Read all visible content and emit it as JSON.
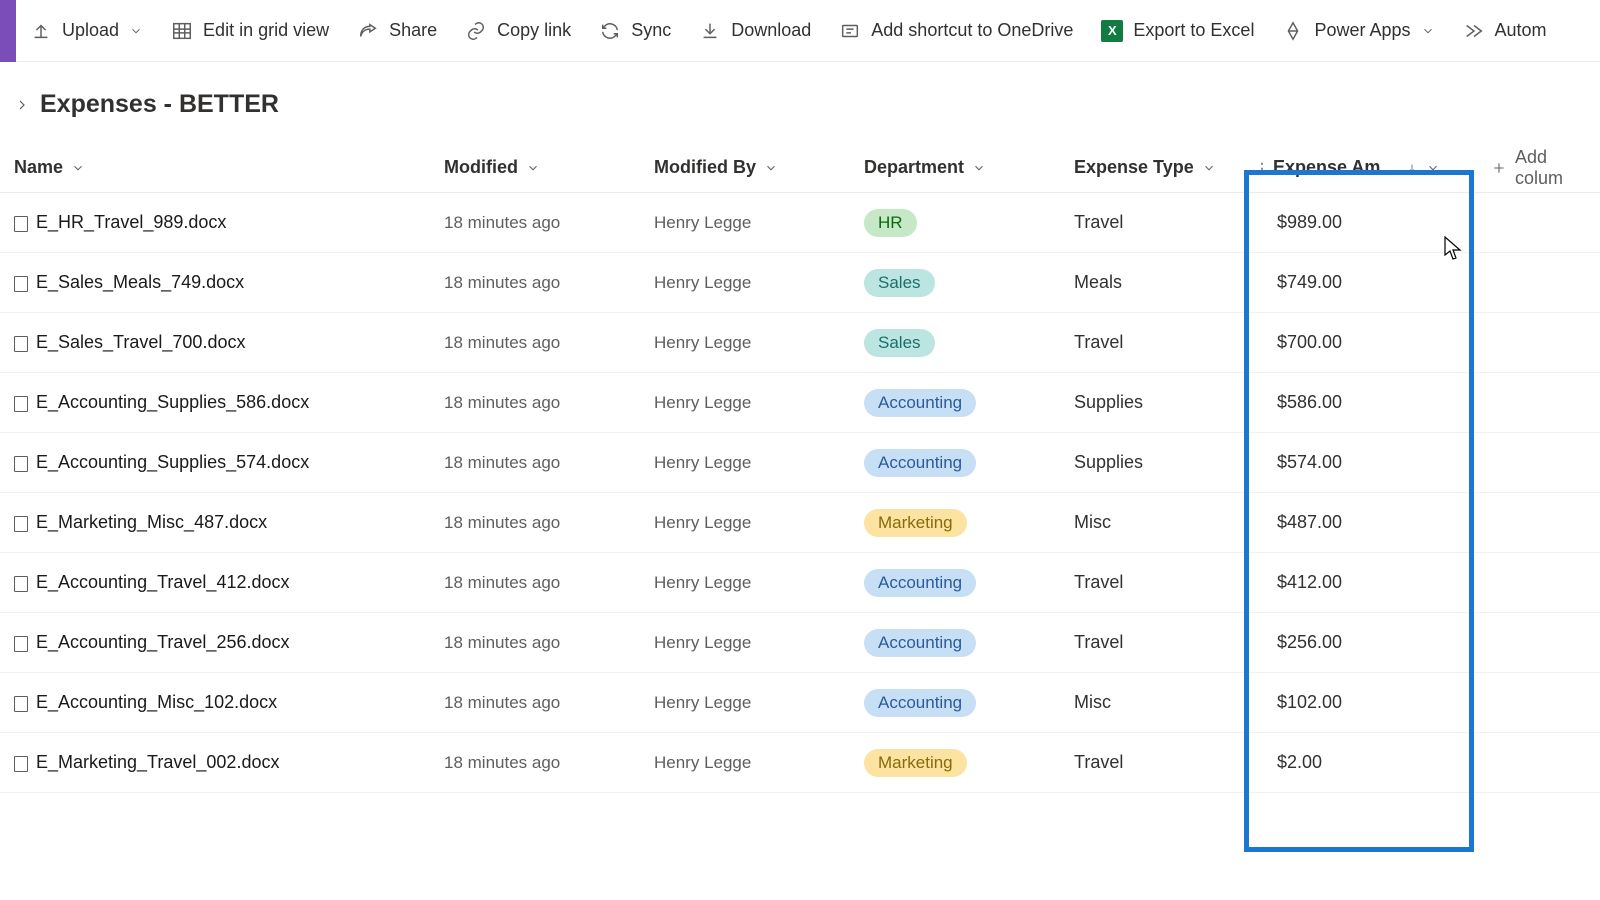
{
  "toolbar": {
    "upload": "Upload",
    "edit_grid": "Edit in grid view",
    "share": "Share",
    "copy_link": "Copy link",
    "sync": "Sync",
    "download": "Download",
    "add_shortcut": "Add shortcut to OneDrive",
    "export_excel": "Export to Excel",
    "power_apps": "Power Apps",
    "automate": "Autom"
  },
  "breadcrumb": {
    "title": "Expenses - BETTER"
  },
  "columns": {
    "name": "Name",
    "modified": "Modified",
    "modified_by": "Modified By",
    "department": "Department",
    "expense_type": "Expense Type",
    "expense_amount": "Expense Am…",
    "add": "Add colum"
  },
  "dept_pills": {
    "HR": "pill-hr",
    "Sales": "pill-sales",
    "Accounting": "pill-accounting",
    "Marketing": "pill-marketing"
  },
  "rows": [
    {
      "name": "E_HR_Travel_989.docx",
      "modified": "18 minutes ago",
      "by": "Henry Legge",
      "dept": "HR",
      "type": "Travel",
      "amount": "$989.00"
    },
    {
      "name": "E_Sales_Meals_749.docx",
      "modified": "18 minutes ago",
      "by": "Henry Legge",
      "dept": "Sales",
      "type": "Meals",
      "amount": "$749.00"
    },
    {
      "name": "E_Sales_Travel_700.docx",
      "modified": "18 minutes ago",
      "by": "Henry Legge",
      "dept": "Sales",
      "type": "Travel",
      "amount": "$700.00"
    },
    {
      "name": "E_Accounting_Supplies_586.docx",
      "modified": "18 minutes ago",
      "by": "Henry Legge",
      "dept": "Accounting",
      "type": "Supplies",
      "amount": "$586.00"
    },
    {
      "name": "E_Accounting_Supplies_574.docx",
      "modified": "18 minutes ago",
      "by": "Henry Legge",
      "dept": "Accounting",
      "type": "Supplies",
      "amount": "$574.00"
    },
    {
      "name": "E_Marketing_Misc_487.docx",
      "modified": "18 minutes ago",
      "by": "Henry Legge",
      "dept": "Marketing",
      "type": "Misc",
      "amount": "$487.00"
    },
    {
      "name": "E_Accounting_Travel_412.docx",
      "modified": "18 minutes ago",
      "by": "Henry Legge",
      "dept": "Accounting",
      "type": "Travel",
      "amount": "$412.00"
    },
    {
      "name": "E_Accounting_Travel_256.docx",
      "modified": "18 minutes ago",
      "by": "Henry Legge",
      "dept": "Accounting",
      "type": "Travel",
      "amount": "$256.00"
    },
    {
      "name": "E_Accounting_Misc_102.docx",
      "modified": "18 minutes ago",
      "by": "Henry Legge",
      "dept": "Accounting",
      "type": "Misc",
      "amount": "$102.00"
    },
    {
      "name": "E_Marketing_Travel_002.docx",
      "modified": "18 minutes ago",
      "by": "Henry Legge",
      "dept": "Marketing",
      "type": "Travel",
      "amount": "$2.00"
    }
  ]
}
